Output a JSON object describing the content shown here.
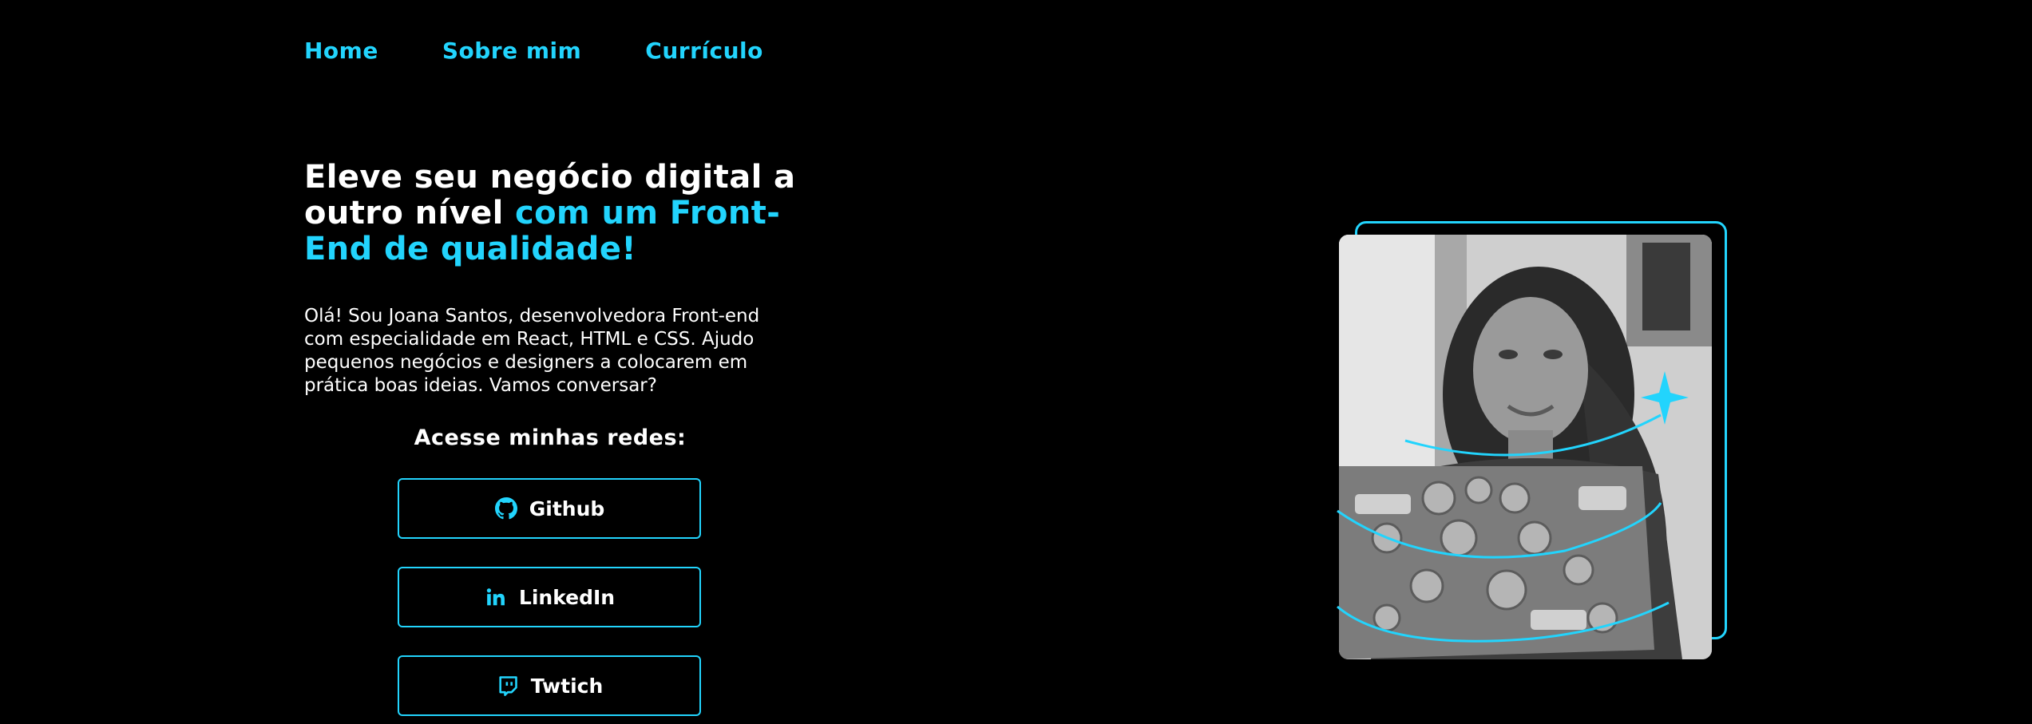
{
  "nav": {
    "items": [
      {
        "label": "Home"
      },
      {
        "label": "Sobre mim"
      },
      {
        "label": "Currículo"
      }
    ]
  },
  "hero": {
    "headline_white": "Eleve seu negócio digital a outro nível ",
    "headline_accent": "com um Front-End de qualidade!",
    "intro": "Olá! Sou Joana Santos, desenvolvedora Front-end com especialidade em React, HTML e CSS. Ajudo pequenos negócios e designers a colocarem em prática boas ideias. Vamos conversar?"
  },
  "social": {
    "title": "Acesse minhas redes:",
    "buttons": [
      {
        "label": "Github",
        "icon": "github-icon"
      },
      {
        "label": "LinkedIn",
        "icon": "linkedin-icon"
      },
      {
        "label": "Twtich",
        "icon": "twitch-icon"
      }
    ]
  },
  "colors": {
    "background": "#000000",
    "accent": "#22D4FD",
    "text": "#FFFFFF"
  }
}
